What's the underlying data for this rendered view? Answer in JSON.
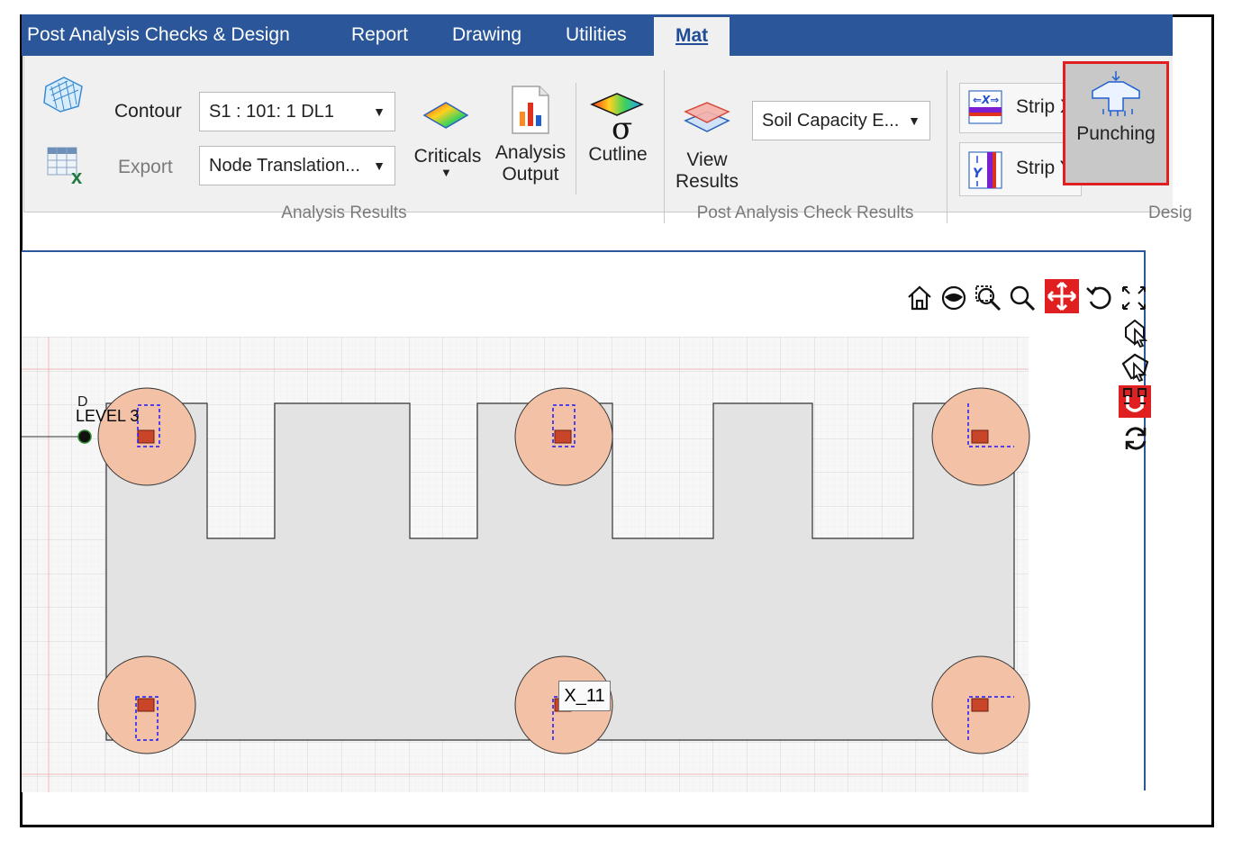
{
  "tabs": [
    {
      "label": "Post Analysis Checks & Design"
    },
    {
      "label": "Report"
    },
    {
      "label": "Drawing"
    },
    {
      "label": "Utilities"
    },
    {
      "label": "Mat",
      "active": true
    }
  ],
  "ribbon": {
    "contour_label": "Contour",
    "export_label": "Export",
    "load_case_select": "S1 : 101: 1 DL1",
    "result_type_select": "Node Translation...",
    "criticals_label": "Criticals",
    "analysis_output_line1": "Analysis",
    "analysis_output_line2": "Output",
    "cutline_label": "Cutline",
    "analysis_results_group": "Analysis Results",
    "view_results_line1": "View",
    "view_results_line2": "Results",
    "soil_capacity_select": "Soil Capacity E...",
    "post_analysis_group": "Post Analysis Check Results",
    "strip_x_label": "Strip X",
    "strip_y_label": "Strip Y",
    "punching_label": "Punching",
    "design_group": "Desig"
  },
  "viewport": {
    "level_label": "LEVEL 3",
    "axis_label": "D",
    "tooltip": "X_11"
  },
  "colors": {
    "tab_bar": "#2b579a",
    "ribbon_bg": "#f0f0f0",
    "slab_fill": "#e3e3e3",
    "punching_circle": "#f2c1a6",
    "column_fill": "#c8452a",
    "selection_dash": "#1a1aff",
    "highlight_red": "#e02020"
  },
  "icons": {
    "toolbar": [
      "home-icon",
      "orbit-icon",
      "zoom-window-icon",
      "zoom-icon",
      "pan-icon",
      "rotate-icon",
      "fit-icon"
    ],
    "side": [
      "select-icon",
      "select-polygon-icon",
      "snap-icon",
      "refresh-icon"
    ]
  }
}
